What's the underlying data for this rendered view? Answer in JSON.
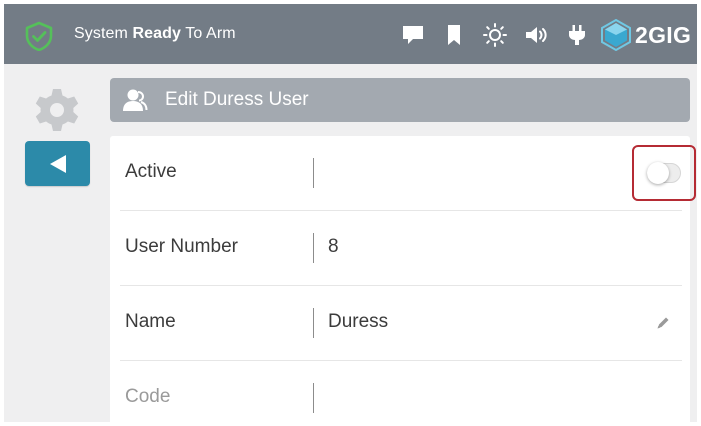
{
  "status_bar": {
    "status_prefix": "System",
    "status_bold": "Ready",
    "status_suffix": "To Arm",
    "brand": "2GIG",
    "icons": [
      "shield-check-icon",
      "message-icon",
      "bookmark-icon",
      "brightness-icon",
      "volume-icon",
      "power-plug-icon",
      "2gig-logo-icon"
    ]
  },
  "sidebar": {
    "icons": [
      "gear-icon",
      "back-arrow-icon"
    ]
  },
  "header": {
    "title": "Edit Duress User",
    "icon": "user-icon"
  },
  "fields": [
    {
      "label": "Active",
      "value": "",
      "control": "toggle",
      "toggle_on": false
    },
    {
      "label": "User Number",
      "value": "8"
    },
    {
      "label": "Name",
      "value": "Duress",
      "icon": "pencil-edit-icon"
    },
    {
      "label": "Code",
      "value": ""
    }
  ],
  "colors": {
    "status_bar": "#737c86",
    "header": "#a3a9b0",
    "back_button": "#2c8aa9",
    "highlight_outline": "#b52b34",
    "background": "#efeff0"
  }
}
